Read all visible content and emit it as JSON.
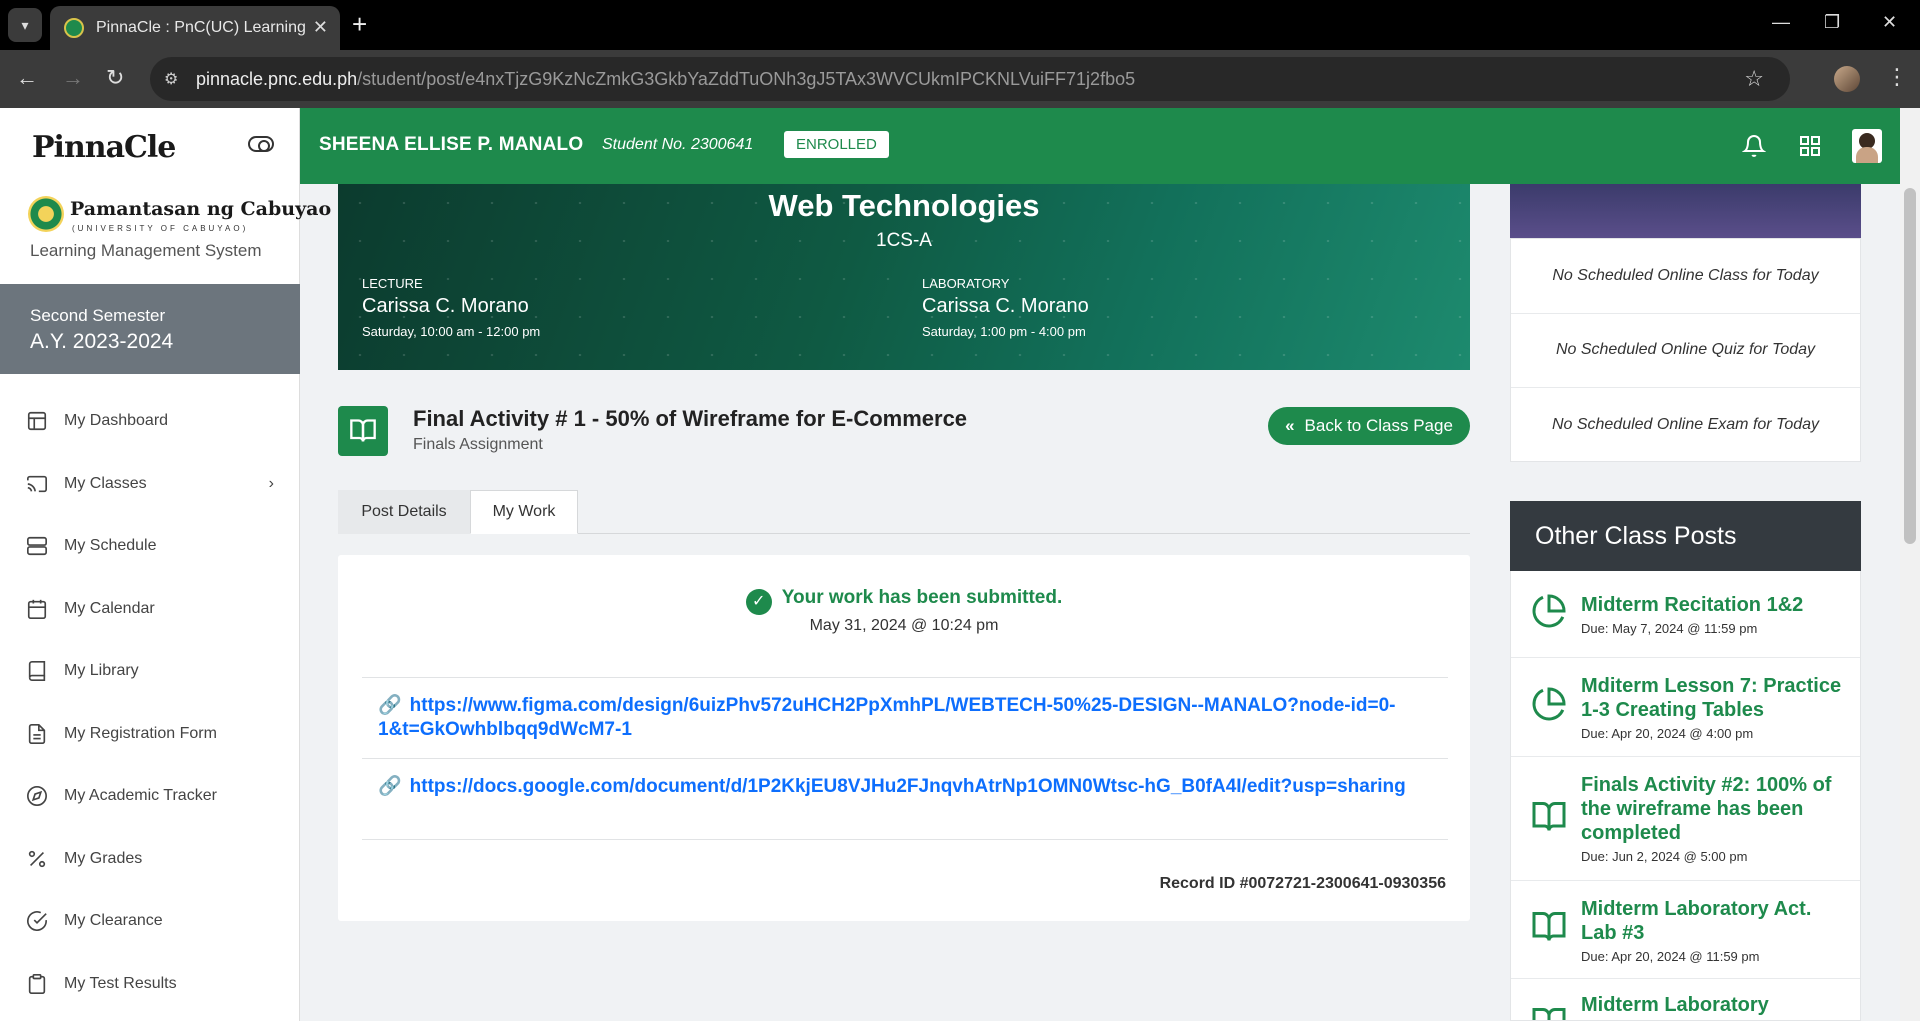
{
  "browser": {
    "tab_title": "PinnaCle : PnC(UC) Learning Ma",
    "url_host": "pinnacle.pnc.edu.ph",
    "url_path": "/student/post/e4nxTjzG9KzNcZmkG3GkbYaZddTuONh3gJ5TAx3WVCUkmIPCKNLVuiFF71j2fbo5"
  },
  "sidebar": {
    "logo_text": "PinnaCle",
    "university_name": "Pamantasan ng Cabuyao",
    "university_sub": "(UNIVERSITY OF CABUYAO)",
    "lms_label": "Learning Management System",
    "semester": "Second Semester",
    "academic_year": "A.Y. 2023-2024",
    "items": [
      {
        "label": "My Dashboard",
        "icon": "dashboard-icon"
      },
      {
        "label": "My Classes",
        "icon": "cast-icon",
        "has_chevron": true
      },
      {
        "label": "My Schedule",
        "icon": "server-icon"
      },
      {
        "label": "My Calendar",
        "icon": "calendar-icon"
      },
      {
        "label": "My Library",
        "icon": "book-icon"
      },
      {
        "label": "My Registration Form",
        "icon": "file-text-icon"
      },
      {
        "label": "My Academic Tracker",
        "icon": "compass-icon"
      },
      {
        "label": "My Grades",
        "icon": "percent-icon"
      },
      {
        "label": "My Clearance",
        "icon": "check-circle-icon"
      },
      {
        "label": "My Test Results",
        "icon": "clipboard-icon"
      }
    ]
  },
  "header": {
    "student_name": "SHEENA ELLISE P. MANALO",
    "student_no": "Student No. 2300641",
    "status_badge": "ENROLLED"
  },
  "banner": {
    "course_title": "Web Technologies",
    "section": "1CS-A",
    "lecture": {
      "label": "LECTURE",
      "instructor": "Carissa C. Morano",
      "schedule": "Saturday, 10:00 am - 12:00 pm"
    },
    "laboratory": {
      "label": "LABORATORY",
      "instructor": "Carissa C. Morano",
      "schedule": "Saturday, 1:00 pm - 4:00 pm"
    }
  },
  "post": {
    "title": "Final Activity # 1 - 50% of Wireframe for E-Commerce",
    "subtitle": "Finals Assignment",
    "back_button": "Back to Class Page"
  },
  "tabs": [
    {
      "label": "Post Details",
      "active": false
    },
    {
      "label": "My Work",
      "active": true
    }
  ],
  "work": {
    "status": "Your work has been submitted.",
    "date": "May 31, 2024 @ 10:24 pm",
    "links": [
      "https://www.figma.com/design/6uizPhv572uHCH2PpXmhPL/WEBTECH-50%25-DESIGN--MANALO?node-id=0-1&t=GkOwhblbqq9dWcM7-1",
      "https://docs.google.com/document/d/1P2KkjEU8VJHu2FJnqvhAtrNp1OMN0Wtsc-hG_B0fA4I/edit?usp=sharing"
    ],
    "record_id": "Record ID #0072721-2300641-0930356"
  },
  "schedule_notes": [
    "No Scheduled Online Class for Today",
    "No Scheduled Online Quiz for Today",
    "No Scheduled Online Exam for Today"
  ],
  "other_posts": {
    "heading": "Other Class Posts",
    "items": [
      {
        "title": "Midterm Recitation 1&2",
        "due": "Due: May 7, 2024 @ 11:59 pm",
        "icon": "pie-chart-icon"
      },
      {
        "title": "Mditerm Lesson 7: Practice 1-3 Creating Tables",
        "due": "Due: Apr 20, 2024 @ 4:00 pm",
        "icon": "pie-chart-icon"
      },
      {
        "title": "Finals Activity #2: 100% of the wireframe has been completed",
        "due": "Due: Jun 2, 2024 @ 5:00 pm",
        "icon": "book-open-icon"
      },
      {
        "title": "Midterm Laboratory Act. Lab #3",
        "due": "Due: Apr 20, 2024 @ 11:59 pm",
        "icon": "book-open-icon"
      },
      {
        "title": "Midterm Laboratory",
        "due": "",
        "icon": "book-open-icon"
      }
    ]
  },
  "colors": {
    "brand_green": "#1e8a4c",
    "link_blue": "#0d6efd",
    "dark_header": "#343a40",
    "semester_gray": "#6c757d"
  }
}
